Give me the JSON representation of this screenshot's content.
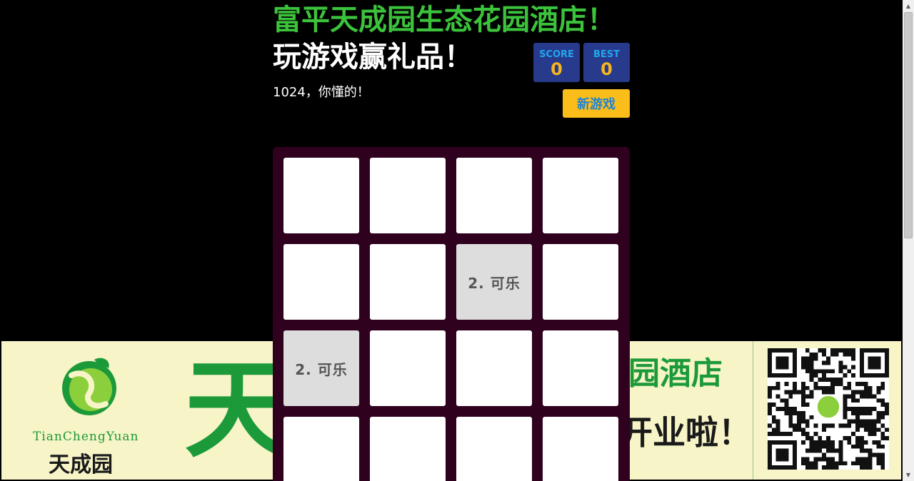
{
  "header": {
    "site_title": "富平天成园生态花园酒店！",
    "game_title": "玩游戏赢礼品！",
    "tagline": "1024，你懂的！"
  },
  "scores": {
    "score_label": "SCORE",
    "score_value": "0",
    "best_label": "BEST",
    "best_value": "0"
  },
  "new_game_label": "新游戏",
  "board": {
    "rows": 4,
    "cols": 4,
    "cells": [
      [
        "",
        "",
        "",
        ""
      ],
      [
        "",
        "",
        "2. 可乐",
        ""
      ],
      [
        "2. 可乐",
        "",
        "",
        ""
      ],
      [
        "",
        "",
        "",
        ""
      ]
    ]
  },
  "banner": {
    "brand_en": "TianChengYuan",
    "brand_cn": "天成园",
    "big_char": "天",
    "hotel_text": "态花园酒店",
    "open_text": "日开业啦！"
  },
  "colors": {
    "page_bg": "#000000",
    "site_title": "#3cc33c",
    "game_title": "#ffffff",
    "tagline": "#ffffff",
    "score_box_bg": "#273a8c",
    "score_label": "#22a7ee",
    "score_value": "#f7b51c",
    "new_game_bg": "#fbbd1a",
    "new_game_text": "#1f83d6",
    "board_bg": "#30001f",
    "cell_empty": "#ffffff",
    "cell_two": "#dddddd",
    "cell_text": "#555555",
    "banner_bg": "#f7f4c8",
    "banner_green": "#1c9a3a",
    "banner_dark": "#1a1a1a"
  },
  "icons": {
    "scroll_up": "▲",
    "scroll_down": "▼"
  }
}
